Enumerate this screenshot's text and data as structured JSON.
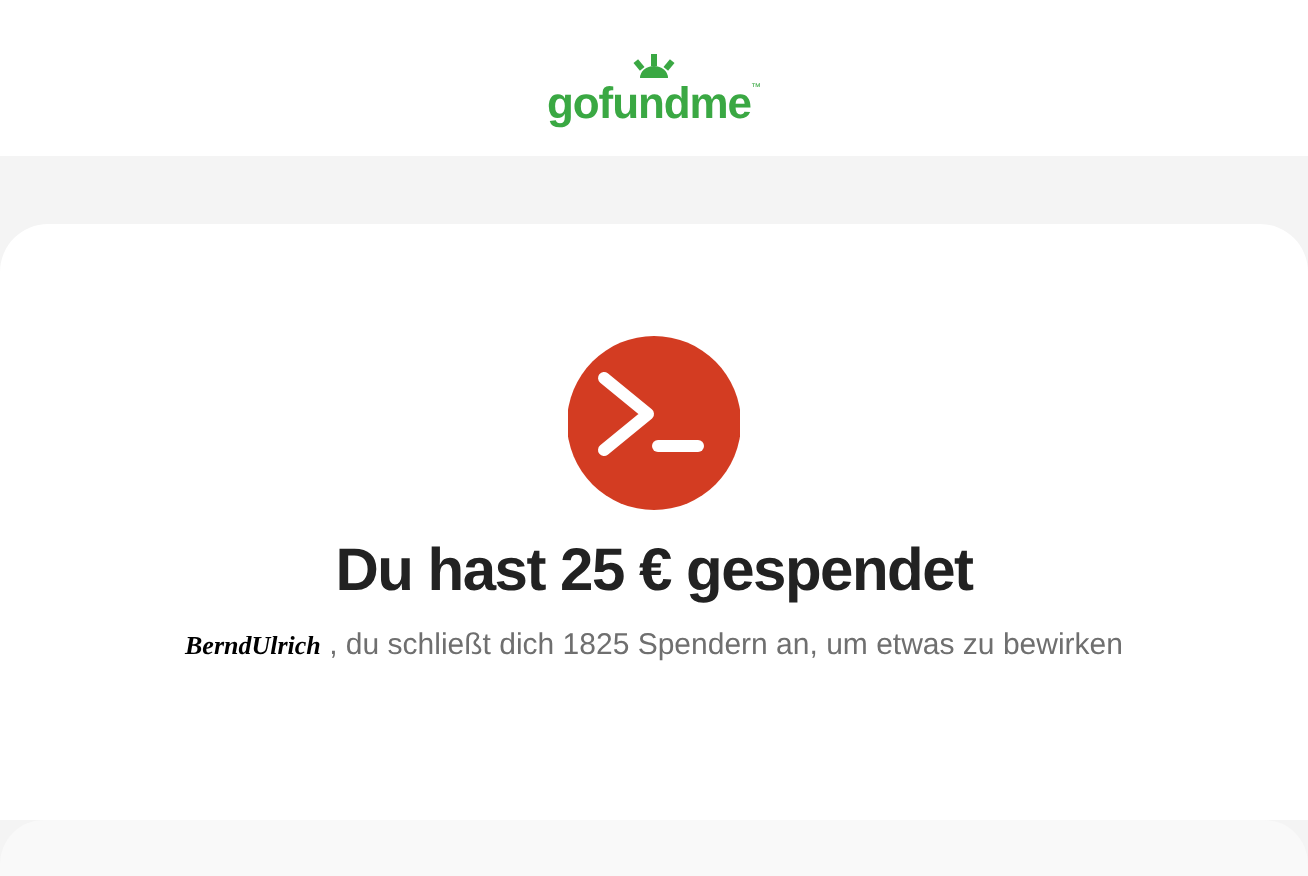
{
  "header": {
    "logo": "gofundme",
    "trademark": "™"
  },
  "confirmation": {
    "title": "Du hast 25 € gespendet",
    "donor_name": "BerndUlrich",
    "message": ", du schließt dich 1825 Spendern an, um etwas zu bewirken"
  }
}
